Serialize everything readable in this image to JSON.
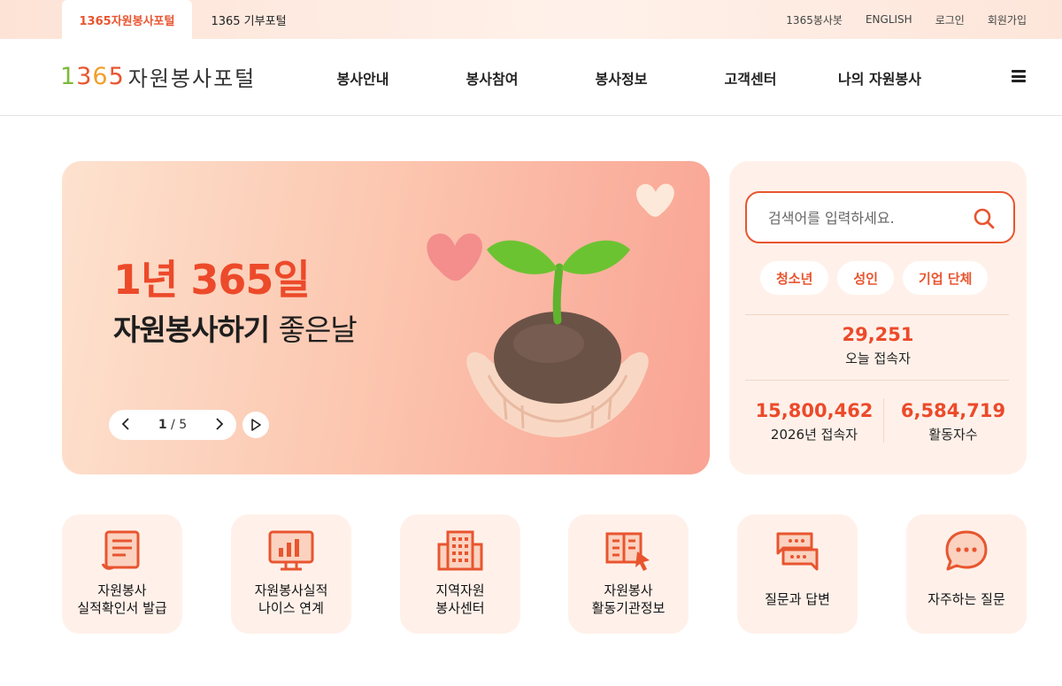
{
  "topbar": {
    "tabs": [
      {
        "label": "1365자원봉사포털",
        "active": true
      },
      {
        "label": "1365 기부포털",
        "active": false
      }
    ],
    "util_links": [
      "1365봉사봇",
      "ENGLISH",
      "로그인",
      "회원가입"
    ]
  },
  "header": {
    "logo": {
      "number": "1365",
      "text": "자원봉사포털"
    },
    "nav": [
      "봉사안내",
      "봉사참여",
      "봉사정보",
      "고객센터",
      "나의 자원봉사"
    ],
    "menu_icon": "hamburger-icon"
  },
  "hero": {
    "title1": "1년 365일",
    "title2_bold": "자원봉사하기",
    "title2_light": "좋은날",
    "pager": {
      "current": "1",
      "separator": "/",
      "total": "5"
    },
    "controls": [
      "chevron-left-icon",
      "chevron-right-icon",
      "play-icon"
    ]
  },
  "search": {
    "placeholder": "검색어를 입력하세요.",
    "value": "",
    "icon": "search-icon"
  },
  "filters": [
    "청소년",
    "성인",
    "기업 단체"
  ],
  "stats": {
    "today": {
      "value": "29,251",
      "label": "오늘 접속자"
    },
    "year": {
      "value": "15,800,462",
      "label": "2026년 접속자"
    },
    "active": {
      "value": "6,584,719",
      "label": "활동자수"
    }
  },
  "quick_menu": [
    {
      "label": "자원봉사\n실적확인서 발급",
      "icon": "certificate-scroll-icon"
    },
    {
      "label": "자원봉사실적\n나이스 연계",
      "icon": "monitor-chart-icon"
    },
    {
      "label": "지역자원\n봉사센터",
      "icon": "building-icon"
    },
    {
      "label": "자원봉사\n활동기관정보",
      "icon": "book-pointer-icon"
    },
    {
      "label": "질문과 답변",
      "icon": "chat-bubbles-icon"
    },
    {
      "label": "자주하는 질문",
      "icon": "speech-bubble-icon"
    }
  ],
  "colors": {
    "accent": "#e8552f",
    "panel": "#fff1ea",
    "green": "#7dba3c",
    "yellow": "#f0a02c"
  }
}
